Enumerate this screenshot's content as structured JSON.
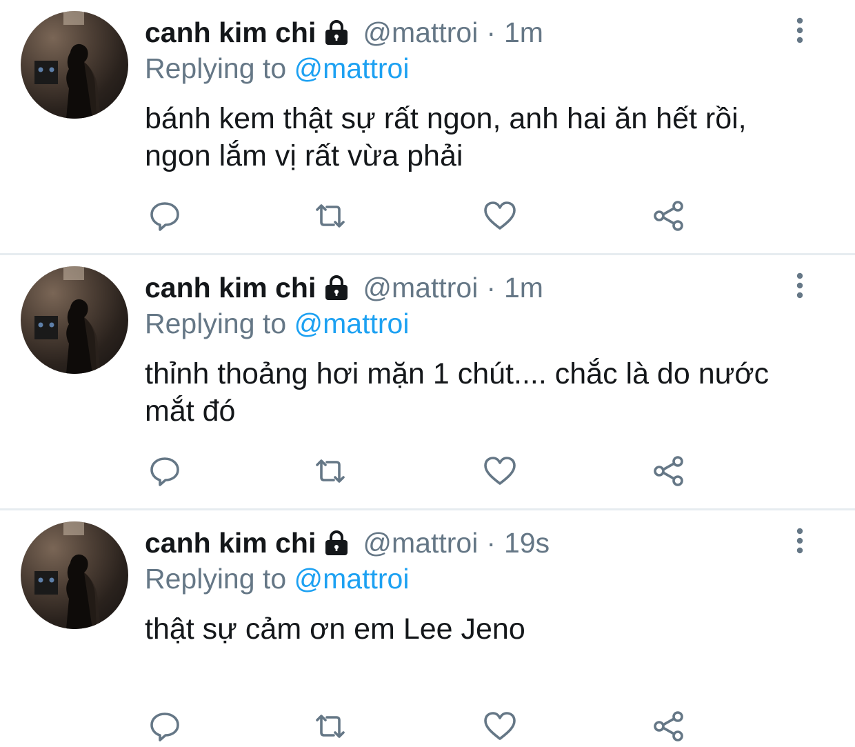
{
  "colors": {
    "text_primary": "#14171a",
    "text_secondary": "#657786",
    "link": "#1da1f2",
    "divider": "#e6ecf0"
  },
  "tweets": [
    {
      "display_name": "canh kim chi",
      "handle": "@mattroi",
      "separator": "·",
      "time": "1m",
      "replying_prefix": "Replying to",
      "replying_to": "@mattroi",
      "text": "bánh kem thật sự rất ngon, anh hai ăn hết rồi, ngon lắm vị rất vừa phải",
      "icons": [
        "lock-icon",
        "more-icon",
        "reply-icon",
        "retweet-icon",
        "like-icon",
        "share-icon"
      ]
    },
    {
      "display_name": "canh kim chi",
      "handle": "@mattroi",
      "separator": "·",
      "time": "1m",
      "replying_prefix": "Replying to",
      "replying_to": "@mattroi",
      "text": "thỉnh thoảng hơi mặn 1 chút.... chắc là do nước mắt đó",
      "icons": [
        "lock-icon",
        "more-icon",
        "reply-icon",
        "retweet-icon",
        "like-icon",
        "share-icon"
      ]
    },
    {
      "display_name": "canh kim chi",
      "handle": "@mattroi",
      "separator": "·",
      "time": "19s",
      "replying_prefix": "Replying to",
      "replying_to": "@mattroi",
      "text": "thật sự cảm ơn em Lee Jeno",
      "icons": [
        "lock-icon",
        "more-icon",
        "reply-icon",
        "retweet-icon",
        "like-icon",
        "share-icon"
      ]
    }
  ]
}
